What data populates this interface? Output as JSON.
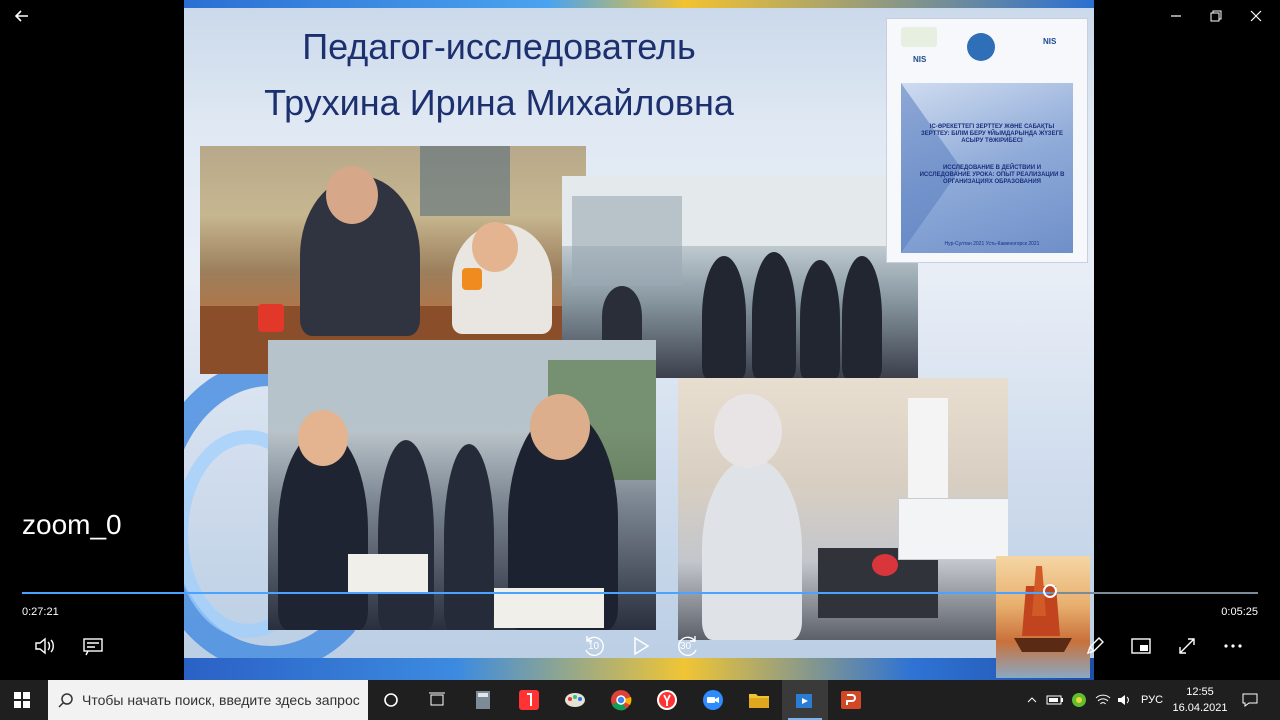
{
  "window": {
    "back_icon": "arrow-left-icon",
    "minimize_glyph": "—",
    "close_glyph": "✕"
  },
  "slide": {
    "title_line1": "Педагог-исследователь",
    "title_line2": "Трухина Ирина Михайловна",
    "cover": {
      "logo_left": "NIS",
      "logo_right": "NIS",
      "kazakh_title": "ІС-ӘРЕКЕТТЕГІ ЗЕРТТЕУ ЖӘНЕ САБАҚТЫ ЗЕРТТЕУ: БІЛІМ БЕРУ ҰЙЫМДАРЫНДА ЖҮЗЕГЕ АСЫРУ ТӘЖІРИБЕСІ",
      "russian_title": "ИССЛЕДОВАНИЕ В ДЕЙСТВИИ И ИССЛЕДОВАНИЕ УРОКА: ОПЫТ РЕАЛИЗАЦИИ В ОРГАНИЗАЦИЯХ ОБРАЗОВАНИЯ",
      "footer": "Нур-Султан 2021 Усть-Каменогорск 2021"
    }
  },
  "player": {
    "zoom_label": "zoom_0",
    "time_elapsed": "0:27:21",
    "time_remaining": "0:05:25",
    "progress_fraction": 0.832,
    "skip_back_label": "10",
    "skip_forward_label": "30"
  },
  "taskbar": {
    "search_placeholder": "Чтобы начать поиск, введите здесь запрос",
    "language": "РУС",
    "time": "12:55",
    "date": "16.04.2021"
  },
  "colors": {
    "accent": "#4aa3ff",
    "title_text": "#1c2f6e",
    "taskbar_bg": "#1f1f1f"
  }
}
